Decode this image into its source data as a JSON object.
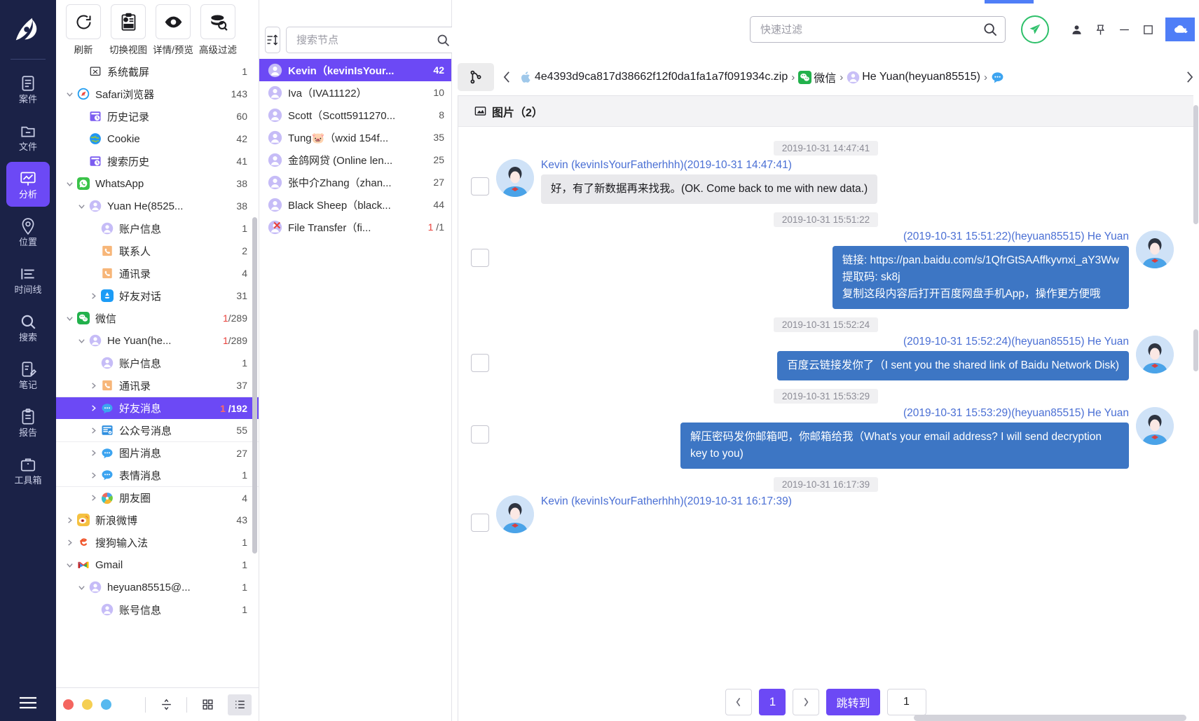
{
  "app": {
    "name": "Forensic Analysis Tool",
    "accent": "#6c49f5",
    "rail_bg": "#1b2247"
  },
  "rail": {
    "items": [
      {
        "label": "案件",
        "icon": "case-clipboard-icon",
        "active": false
      },
      {
        "label": "文件",
        "icon": "folder-icon",
        "active": false
      },
      {
        "label": "分析",
        "icon": "analysis-monitor-icon",
        "active": true
      },
      {
        "label": "位置",
        "icon": "location-pin-icon",
        "active": false
      },
      {
        "label": "时间线",
        "icon": "timeline-icon",
        "active": false
      },
      {
        "label": "搜索",
        "icon": "search-icon",
        "active": false
      },
      {
        "label": "笔记",
        "icon": "note-pencil-icon",
        "active": false
      },
      {
        "label": "报告",
        "icon": "report-clipboard-icon",
        "active": false
      },
      {
        "label": "工具箱",
        "icon": "toolbox-icon",
        "active": false
      }
    ],
    "menu_icon": "hamburger-menu-icon"
  },
  "toolbar": {
    "buttons": [
      {
        "label": "刷新",
        "icon": "refresh-icon"
      },
      {
        "label": "切换视图",
        "icon": "switch-view-icon"
      },
      {
        "label": "详情/预览",
        "icon": "eye-preview-icon"
      },
      {
        "label": "高级过滤",
        "icon": "advanced-filter-icon"
      }
    ]
  },
  "tree": {
    "nodes": [
      {
        "indent": 1,
        "twisty": "none",
        "icon": "screenshot-icon",
        "label": "系统截屏",
        "count": "1"
      },
      {
        "indent": 0,
        "twisty": "down",
        "icon": "safari-icon",
        "label": "Safari浏览器",
        "count": "143"
      },
      {
        "indent": 1,
        "twisty": "none",
        "icon": "history-icon",
        "label": "历史记录",
        "count": "60"
      },
      {
        "indent": 1,
        "twisty": "none",
        "icon": "cookie-globe-icon",
        "label": "Cookie",
        "count": "42"
      },
      {
        "indent": 1,
        "twisty": "none",
        "icon": "history-icon",
        "label": "搜索历史",
        "count": "41"
      },
      {
        "indent": 0,
        "twisty": "down",
        "icon": "whatsapp-icon",
        "label": "WhatsApp",
        "count": "38"
      },
      {
        "indent": 1,
        "twisty": "down",
        "icon": "user-icon",
        "label": "Yuan He(8525...",
        "count": "38"
      },
      {
        "indent": 2,
        "twisty": "none",
        "icon": "user-icon",
        "label": "账户信息",
        "count": "1"
      },
      {
        "indent": 2,
        "twisty": "none",
        "icon": "contacts-icon",
        "label": "联系人",
        "count": "2"
      },
      {
        "indent": 2,
        "twisty": "none",
        "icon": "contacts-icon",
        "label": "通讯录",
        "count": "4"
      },
      {
        "indent": 2,
        "twisty": "right",
        "icon": "appstore-icon",
        "label": "好友对话",
        "count": "31"
      },
      {
        "indent": 0,
        "twisty": "down",
        "icon": "wechat-icon",
        "label": "微信",
        "count": "1/289",
        "count_red_prefix": "1"
      },
      {
        "indent": 1,
        "twisty": "down",
        "icon": "user-icon",
        "label": "He Yuan(he...",
        "count": "1/289",
        "count_red_prefix": "1"
      },
      {
        "indent": 2,
        "twisty": "none",
        "icon": "user-icon",
        "label": "账户信息",
        "count": "1"
      },
      {
        "indent": 2,
        "twisty": "right",
        "icon": "contacts-icon",
        "label": "通讯录",
        "count": "37"
      },
      {
        "indent": 2,
        "twisty": "right",
        "icon": "chat-bubble-icon",
        "label": "好友消息",
        "count": "1 /192",
        "count_red_prefix": "1",
        "selected": true,
        "divider": true
      },
      {
        "indent": 2,
        "twisty": "right",
        "icon": "official-acct-icon",
        "label": "公众号消息",
        "count": "55"
      },
      {
        "indent": 2,
        "twisty": "right",
        "icon": "chat-bubble-icon",
        "label": "图片消息",
        "count": "27",
        "divider": true
      },
      {
        "indent": 2,
        "twisty": "right",
        "icon": "chat-bubble-icon",
        "label": "表情消息",
        "count": "1"
      },
      {
        "indent": 2,
        "twisty": "right",
        "icon": "moments-icon",
        "label": "朋友圈",
        "count": "4",
        "divider": true
      },
      {
        "indent": 0,
        "twisty": "right",
        "icon": "weibo-icon",
        "label": "新浪微博",
        "count": "43"
      },
      {
        "indent": 0,
        "twisty": "right",
        "icon": "sogou-icon",
        "label": "搜狗输入法",
        "count": "1"
      },
      {
        "indent": 0,
        "twisty": "down",
        "icon": "gmail-icon",
        "label": "Gmail",
        "count": "1"
      },
      {
        "indent": 1,
        "twisty": "down",
        "icon": "user-icon",
        "label": "heyuan85515@...",
        "count": "1"
      },
      {
        "indent": 2,
        "twisty": "none",
        "icon": "user-icon",
        "label": "账号信息",
        "count": "1"
      }
    ],
    "footer": {
      "dots": [
        "#f4655f",
        "#f5cf52",
        "#57b9ef"
      ],
      "buttons": [
        {
          "icon": "collapse-expand-icon",
          "active": false
        },
        {
          "icon": "grid-view-icon",
          "active": false
        },
        {
          "icon": "list-view-icon",
          "active": true
        }
      ]
    }
  },
  "node_list": {
    "sort_icon": "sort-icon",
    "search": {
      "placeholder": "搜索节点",
      "value": "",
      "icon": "search-icon"
    },
    "items": [
      {
        "name": "Kevin（kevinIsYour...",
        "count": "42",
        "selected": true
      },
      {
        "name": "Iva（IVA11122）",
        "count": "10"
      },
      {
        "name": "Scott（Scott5911270...",
        "count": "8"
      },
      {
        "name": "Tung🐷（wxid 154f...",
        "count": "35"
      },
      {
        "name": "金鸽网贷 (Online len...",
        "count": "25"
      },
      {
        "name": "张中介Zhang（zhan...",
        "count": "27"
      },
      {
        "name": "Black Sheep（black...",
        "count": "44"
      },
      {
        "name": "File Transfer（fi...",
        "count": "1 /1",
        "count_red_prefix": "1",
        "deleted": true
      }
    ]
  },
  "topbar": {
    "filter": {
      "placeholder": "快速过滤",
      "value": "",
      "icon": "search-icon"
    },
    "send_icon": "send-paper-plane-icon",
    "user_icon": "user-account-icon",
    "pin_icon": "pin-icon",
    "minimize_icon": "minimize-icon",
    "maximize_icon": "maximize-icon",
    "corner_icon": "cloud-download-icon"
  },
  "breadcrumb": {
    "branch_icon": "branch-tree-icon",
    "back_icon": "chevron-left-icon",
    "forward_icon": "chevron-right-icon",
    "items": [
      {
        "icon": "apple-icon",
        "label": "4e4393d9ca817d38662f12f0da1fa1a7f091934c.zip"
      },
      {
        "icon": "wechat-icon",
        "label": "微信"
      },
      {
        "icon": "user-icon",
        "label": "He Yuan(heyuan85515)"
      },
      {
        "icon": "chat-bubble-icon",
        "label": ""
      }
    ],
    "separator": "›"
  },
  "panel": {
    "header": {
      "icon": "image-icon",
      "title": "图片（2）"
    }
  },
  "chat": {
    "messages": [
      {
        "timestamp": "2019-10-31 14:47:41",
        "direction": "in",
        "sender": "Kevin (kevinIsYourFatherhhh)(2019-10-31 14:47:41)",
        "text": "好，有了新数据再来找我。(OK. Come back to me with new data.)",
        "avatar": "contact-avatar"
      },
      {
        "timestamp": "2019-10-31 15:51:22",
        "direction": "out",
        "sender": "(2019-10-31 15:51:22)(heyuan85515) He Yuan",
        "text": "链接: https://pan.baidu.com/s/1QfrGtSAAffkyvnxi_aY3Ww\n提取码: sk8j\n复制这段内容后打开百度网盘手机App，操作更方便哦",
        "avatar": "owner-avatar"
      },
      {
        "timestamp": "2019-10-31 15:52:24",
        "direction": "out",
        "sender": "(2019-10-31 15:52:24)(heyuan85515) He Yuan",
        "text": "百度云链接发你了（I sent you the shared link of Baidu Network Disk)",
        "avatar": "owner-avatar"
      },
      {
        "timestamp": "2019-10-31 15:53:29",
        "direction": "out",
        "sender": "(2019-10-31 15:53:29)(heyuan85515) He Yuan",
        "text": "解压密码发你邮箱吧，你邮箱给我（What's your email address? I will send decryption key to you)",
        "avatar": "owner-avatar"
      },
      {
        "timestamp": "2019-10-31 16:17:39",
        "direction": "in",
        "sender": "Kevin (kevinIsYourFatherhhh)(2019-10-31 16:17:39)",
        "text": "",
        "avatar": "contact-avatar"
      }
    ]
  },
  "pagination": {
    "prev_icon": "chevron-left-icon",
    "next_icon": "chevron-right-icon",
    "current_page": "1",
    "jump_label": "跳转到",
    "jump_value": "1"
  }
}
